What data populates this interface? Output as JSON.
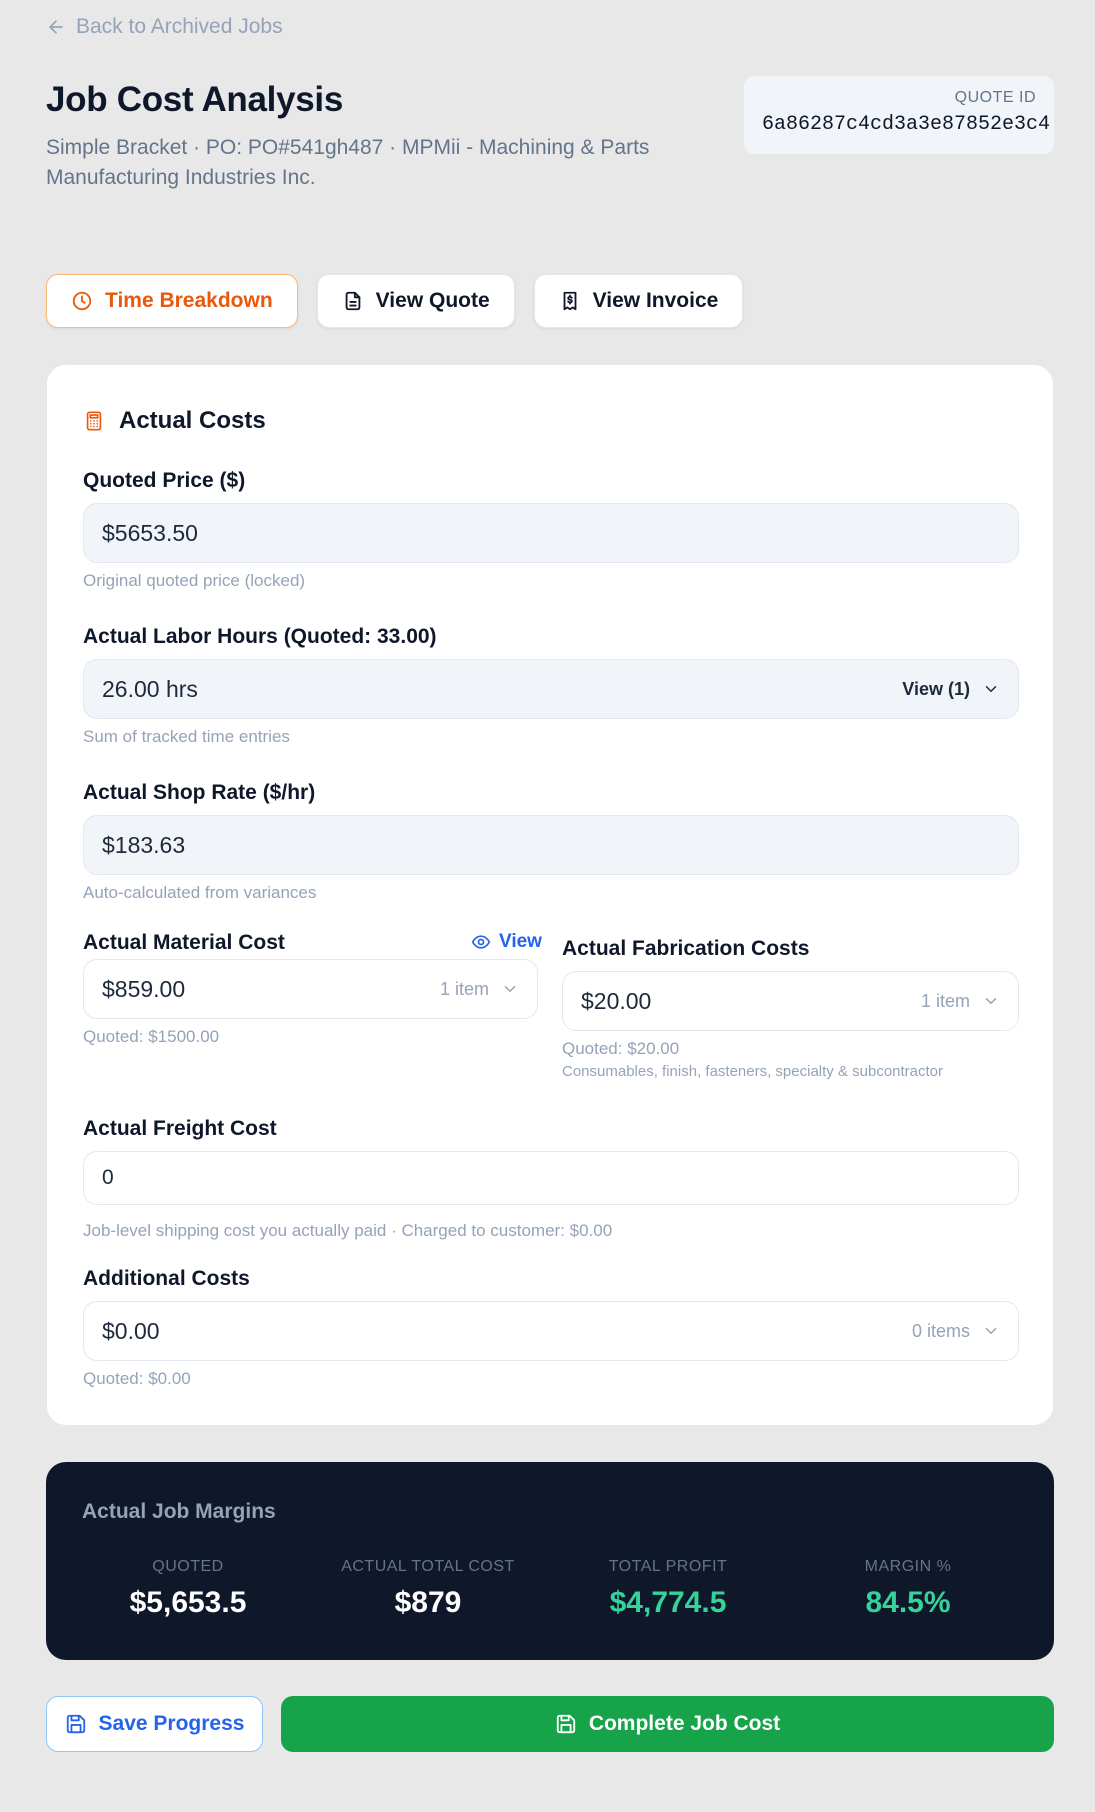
{
  "nav": {
    "back_label": "Back to Archived Jobs"
  },
  "header": {
    "title": "Job Cost Analysis",
    "subtitle": "Simple Bracket · PO: PO#541gh487 · MPMii - Machining & Parts Manufacturing Industries Inc.",
    "quote_id_label": "QUOTE ID",
    "quote_id_value": "6a86287c4cd3a3e87852e3c4"
  },
  "tabs": [
    {
      "label": "Time Breakdown",
      "icon": "clock-icon",
      "active": true
    },
    {
      "label": "View Quote",
      "icon": "document-icon",
      "active": false
    },
    {
      "label": "View Invoice",
      "icon": "invoice-icon",
      "active": false
    }
  ],
  "costs": {
    "heading": "Actual Costs",
    "quoted_price": {
      "label": "Quoted Price ($)",
      "value": "$5653.50",
      "hint": "Original quoted price (locked)"
    },
    "labor_hours": {
      "label": "Actual Labor Hours (Quoted: 33.00)",
      "value": "26.00 hrs",
      "action": "View (1)",
      "hint": "Sum of tracked time entries"
    },
    "shop_rate": {
      "label": "Actual Shop Rate ($/hr)",
      "value": "$183.63",
      "hint": "Auto-calculated from variances"
    },
    "material": {
      "label": "Actual Material Cost",
      "view": "View",
      "value": "$859.00",
      "count": "1 item",
      "hint": "Quoted: $1500.00"
    },
    "fabrication": {
      "label": "Actual Fabrication Costs",
      "value": "$20.00",
      "count": "1 item",
      "hint": "Quoted: $20.00",
      "sub_hint": "Consumables, finish, fasteners, specialty & subcontractor"
    },
    "freight": {
      "label": "Actual Freight Cost",
      "value": "0",
      "hint": "Job-level shipping cost you actually paid · Charged to customer: $0.00"
    },
    "additional": {
      "label": "Additional Costs",
      "value": "$0.00",
      "count": "0 items",
      "hint": "Quoted: $0.00"
    }
  },
  "margins": {
    "title": "Actual Job Margins",
    "quoted_label": "QUOTED",
    "quoted_value": "$5,653.5",
    "cost_label": "ACTUAL TOTAL COST",
    "cost_value": "$879",
    "profit_label": "TOTAL PROFIT",
    "profit_value": "$4,774.5",
    "margin_label": "MARGIN %",
    "margin_value": "84.5%"
  },
  "actions": {
    "save_label": "Save Progress",
    "complete_label": "Complete Job Cost"
  },
  "colors": {
    "accent_orange": "#ea580c",
    "link_blue": "#2563eb",
    "success_green": "#16a34a",
    "profit_green": "#34d399",
    "dark_panel": "#0f172a"
  }
}
